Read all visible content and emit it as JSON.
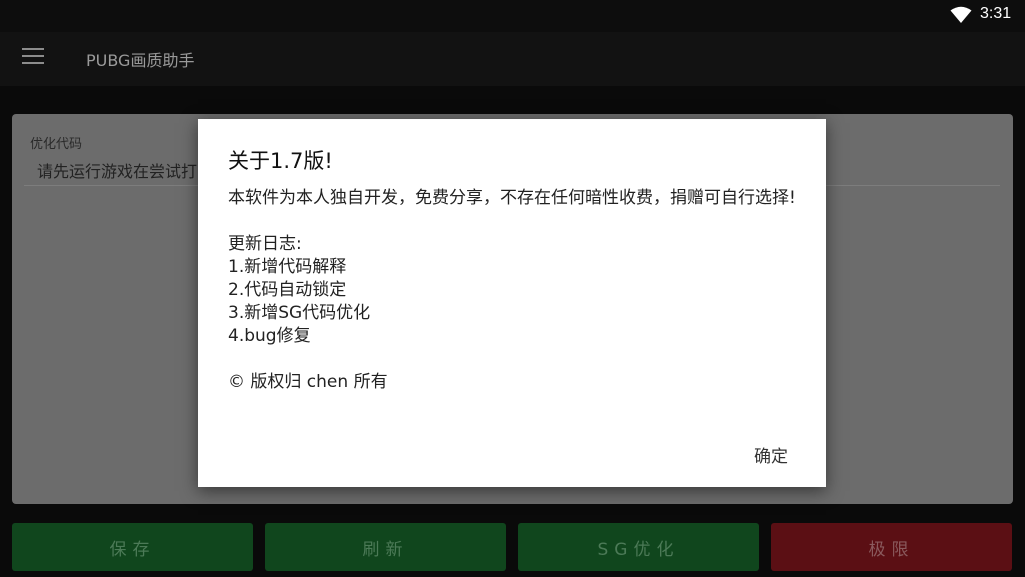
{
  "status_bar": {
    "time": "3:31",
    "wifi_icon": "wifi-icon"
  },
  "app_bar": {
    "menu_icon": "menu-icon",
    "title": "PUBG画质助手"
  },
  "card": {
    "label": "优化代码",
    "text": "请先运行游戏在尝试打"
  },
  "buttons": [
    {
      "label": "保存",
      "color": "#10461d"
    },
    {
      "label": "刷新",
      "color": "#10461d"
    },
    {
      "label": "SG优化",
      "color": "#10461d"
    },
    {
      "label": "极限",
      "color": "#5b0f14"
    }
  ],
  "dialog": {
    "title": "关于1.7版!",
    "intro": "本软件为本人独自开发，免费分享，不存在任何暗性收费，捐赠可自行选择!",
    "log_title": "更新日志:",
    "log_items": [
      "1.新增代码解释",
      "2.代码自动锁定",
      "3.新增SG代码优化",
      "4.bug修复"
    ],
    "copyright": "© 版权归 chen 所有",
    "ok_label": "确定"
  }
}
